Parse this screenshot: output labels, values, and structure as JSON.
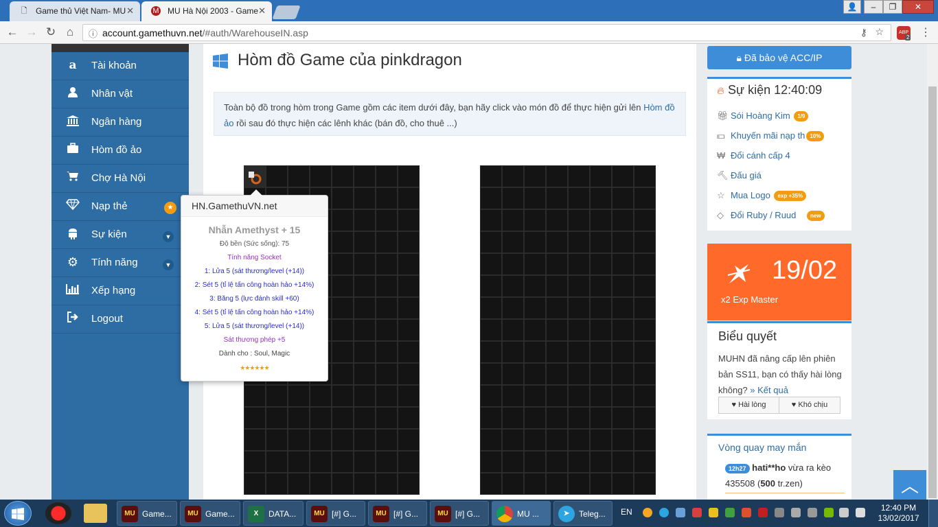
{
  "browser": {
    "tabs": [
      {
        "title": "Game thủ Việt Nam- MU",
        "active": false
      },
      {
        "title": "MU Hà Nội 2003 - Game",
        "active": true
      }
    ],
    "url_host": "account.gamethuvn.net",
    "url_path": "/#auth/WarehouseIN.asp",
    "ext_badge": "ABP",
    "ext_count": "2"
  },
  "sidebar": {
    "items": [
      {
        "label": "Tài khoản",
        "icon": "amazon-icon"
      },
      {
        "label": "Nhân vật",
        "icon": "user-icon"
      },
      {
        "label": "Ngân hàng",
        "icon": "bank-icon"
      },
      {
        "label": "Hòm đồ ảo",
        "icon": "briefcase-icon"
      },
      {
        "label": "Chợ Hà Nội",
        "icon": "cart-icon"
      },
      {
        "label": "Nạp thẻ",
        "icon": "diamond-icon"
      },
      {
        "label": "Sự kiện",
        "icon": "android-icon"
      },
      {
        "label": "Tính năng",
        "icon": "gears-icon"
      },
      {
        "label": "Xếp hạng",
        "icon": "bar-chart-icon"
      },
      {
        "label": "Logout",
        "icon": "logout-icon"
      }
    ]
  },
  "main": {
    "title": "Hòm đồ Game của pinkdragon",
    "info_before": "Toàn bộ đồ trong hòm trong Game gồm các item dưới đây, bạn hãy click vào món đồ để thực hiện gửi lên ",
    "info_link": "Hòm đồ ảo",
    "info_after": " rồi sau đó thực hiện các lênh khác (bán đồ, cho thuê ...)"
  },
  "tooltip": {
    "header": "HN.GamethuVN.net",
    "item_name": "Nhẫn Amethyst + 15",
    "durability": "Độ bền (Sức sống): 75",
    "socket_title": "Tính năng Socket",
    "sockets": [
      "1: Lửa 5 (sát thương/level (+14))",
      "2: Sét 5 (tỉ lệ tấn công hoàn hảo +14%)",
      "3: Băng 5 (lực đánh skill +60)",
      "4: Sét 5 (tỉ lệ tấn công hoàn hảo +14%)",
      "5: Lửa 5 (sát thương/level (+14))"
    ],
    "magic_damage": "Sát thương phép +5",
    "class_for": "Dành cho : Soul, Magic",
    "stars": "★★★★★★"
  },
  "right": {
    "protect_label": "Đã bảo vệ ACC/IP",
    "events_title": "Sự kiện 12:40:09",
    "events": [
      {
        "label": "Sói Hoàng Kim",
        "badge": "1/9",
        "icon": "gift-icon"
      },
      {
        "label": "Khuyến mãi nạp th",
        "badge": "10%",
        "icon": "money-icon"
      },
      {
        "label": "Đổi cánh cấp 4",
        "badge": "",
        "icon": "won-icon"
      },
      {
        "label": "Đấu giá",
        "badge": "",
        "icon": "gavel-icon"
      },
      {
        "label": "Mua Logo",
        "badge": "exp +35%",
        "icon": "star-icon"
      },
      {
        "label": "Đổi Ruby / Ruud",
        "badge": "new",
        "icon": "diamond-icon"
      }
    ],
    "promo_date": "19/02",
    "promo_text": "x2 Exp Master",
    "poll_title": "Biểu quyết",
    "poll_question": "MUHN đã nâng cấp lên phiên bản SS11, bạn có thấy hài lòng không?",
    "poll_result_link": "» Kết quả",
    "poll_yes": "Hài lòng",
    "poll_no": "Khó chịu",
    "wheel_title": "Vòng quay may mắn",
    "wheel_time": "12h27",
    "wheel_user": "hati**ho",
    "wheel_text_mid": " vừa ra kèo 435508 (",
    "wheel_amount": "500",
    "wheel_text_end": " tr.zen)"
  },
  "taskbar": {
    "buttons": [
      {
        "label": "Game..."
      },
      {
        "label": "Game..."
      },
      {
        "label": "DATA..."
      },
      {
        "label": "[#] G..."
      },
      {
        "label": "[#] G..."
      },
      {
        "label": "[#] G..."
      },
      {
        "label": "MU ..."
      },
      {
        "label": "Teleg..."
      }
    ],
    "lang": "EN",
    "time": "12:40 PM",
    "date": "13/02/2017"
  }
}
